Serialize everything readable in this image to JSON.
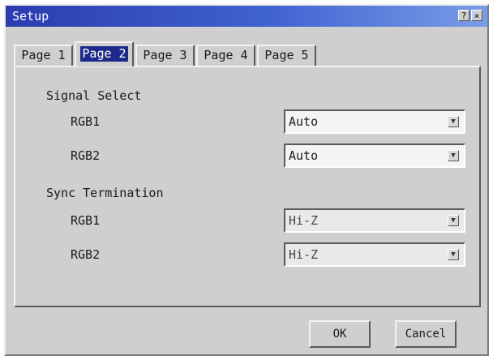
{
  "window": {
    "title": "Setup",
    "help_glyph": "?",
    "close_glyph": "×"
  },
  "tabs": [
    {
      "label": "Page 1",
      "active": false
    },
    {
      "label": "Page 2",
      "active": true
    },
    {
      "label": "Page 3",
      "active": false
    },
    {
      "label": "Page 4",
      "active": false
    },
    {
      "label": "Page 5",
      "active": false
    }
  ],
  "signal_select": {
    "title": "Signal Select",
    "rgb1": {
      "label": "RGB1",
      "value": "Auto"
    },
    "rgb2": {
      "label": "RGB2",
      "value": "Auto"
    }
  },
  "sync_termination": {
    "title": "Sync Termination",
    "rgb1": {
      "label": "RGB1",
      "value": "Hi-Z"
    },
    "rgb2": {
      "label": "RGB2",
      "value": "Hi-Z"
    }
  },
  "buttons": {
    "ok": "OK",
    "cancel": "Cancel"
  },
  "icons": {
    "dropdown_arrow": "chevron-down-icon",
    "arrow_glyph": "▼"
  },
  "colors": {
    "titlebar_start": "#2b3cae",
    "titlebar_end": "#7a9ce6",
    "active_tab_highlight": "#1e2a8a",
    "dialog_background": "#cfcfcf"
  }
}
